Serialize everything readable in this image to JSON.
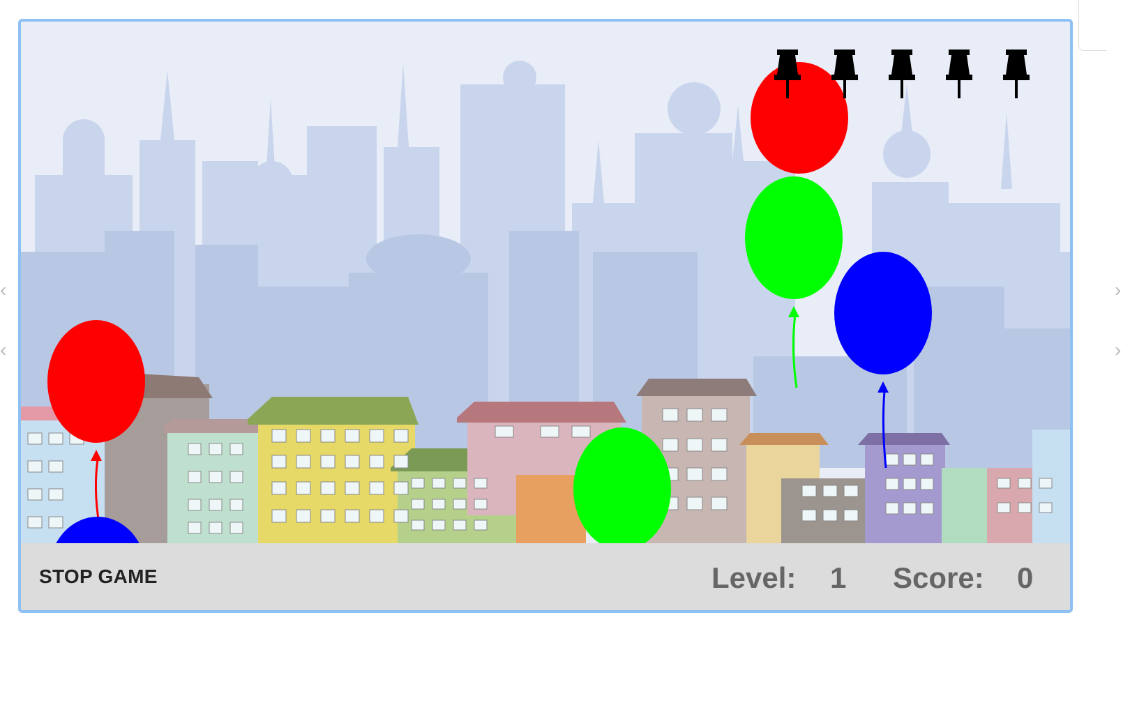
{
  "controls": {
    "stop_label": "STOP GAME"
  },
  "stats": {
    "level_label": "Level:",
    "level_value": "1",
    "score_label": "Score:",
    "score_value": "0"
  },
  "lives": {
    "count": 5,
    "icon": "pushpin-icon"
  },
  "balloons": [
    {
      "color": "red"
    },
    {
      "color": "green"
    },
    {
      "color": "blue"
    },
    {
      "color": "red"
    },
    {
      "color": "blue"
    },
    {
      "color": "green"
    }
  ],
  "colors": {
    "red": "#ff0000",
    "green": "#00ff00",
    "blue": "#0000ff",
    "frame_border": "#8ec0f4",
    "status_bar": "#dcdcdc"
  }
}
